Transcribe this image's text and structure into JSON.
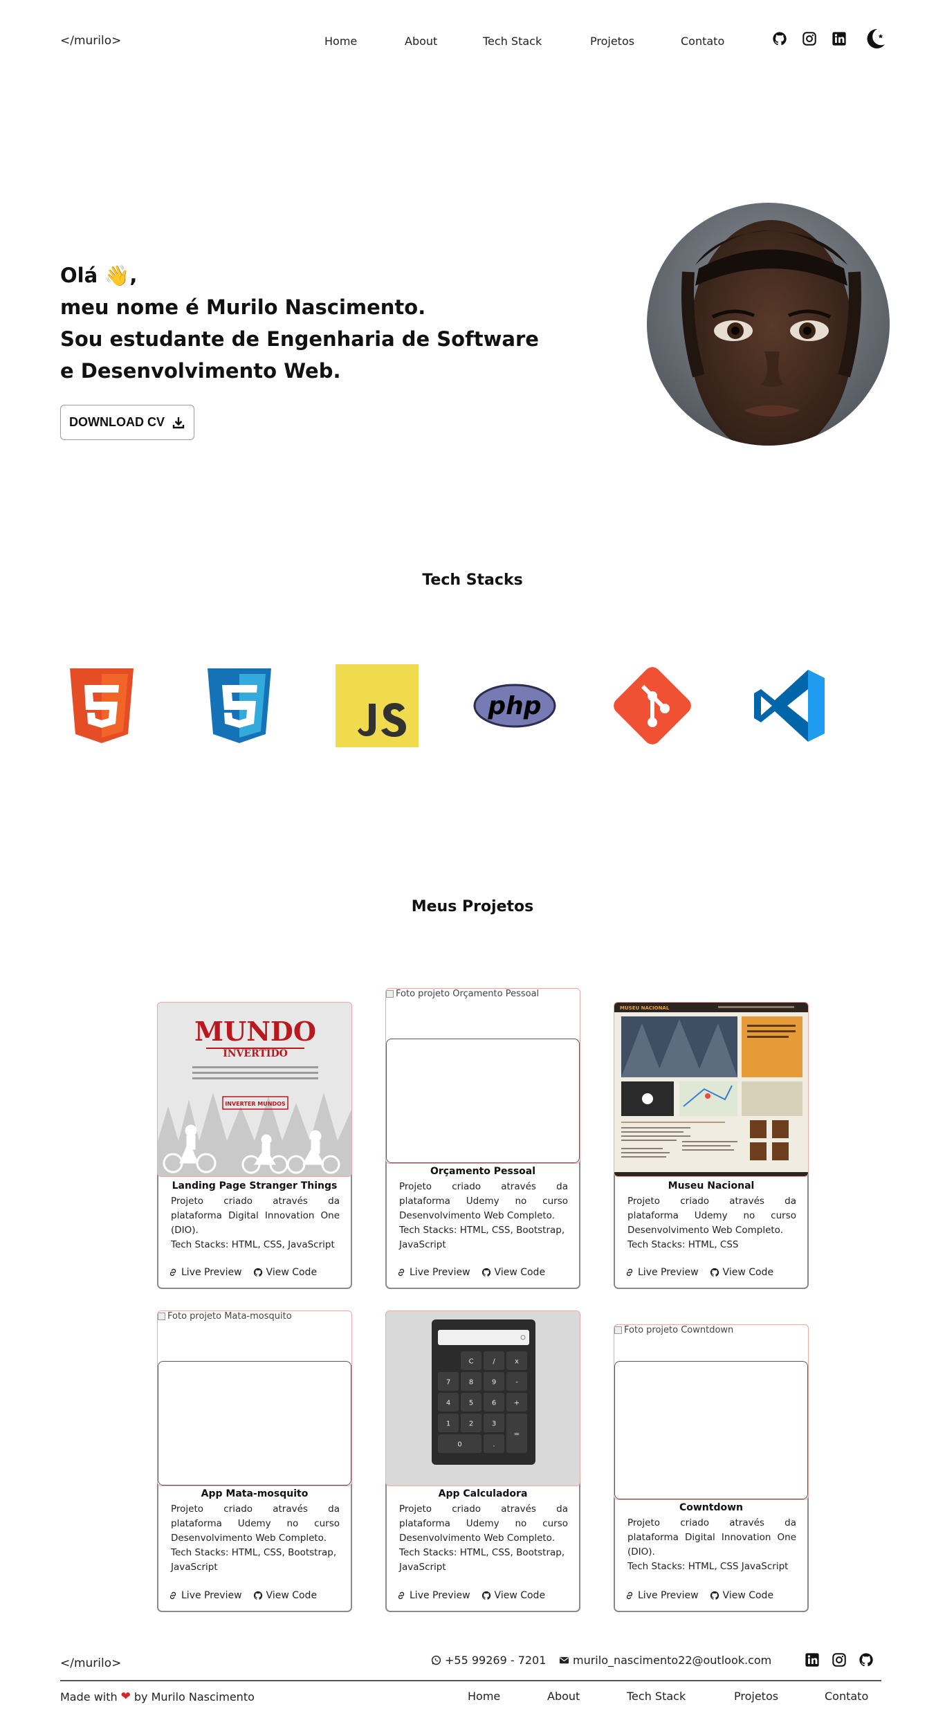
{
  "header": {
    "logo": "</murilo>",
    "nav": [
      "Home",
      "About",
      "Tech Stack",
      "Projetos",
      "Contato"
    ],
    "icons": [
      "github-icon",
      "instagram-icon",
      "linkedin-icon",
      "theme-toggle-icon"
    ]
  },
  "hero": {
    "line1": "Olá 👋,",
    "line2": "meu nome é Murilo Nascimento.",
    "line3": "Sou estudante de Engenharia de Software",
    "line4": "e Desenvolvimento Web.",
    "cv_label": "DOWNLOAD CV"
  },
  "tech": {
    "title": "Tech Stacks",
    "items": [
      "html5-logo",
      "css3-logo",
      "javascript-logo",
      "php-logo",
      "git-logo",
      "vscode-logo"
    ]
  },
  "projects": {
    "title": "Meus Projetos",
    "live_label": "Live Preview",
    "code_label": "View Code",
    "items": [
      {
        "title": "Landing Page Stranger Things",
        "desc": "Projeto criado através da plataforma Digital Innovation One (DIO).",
        "stack": "Tech Stacks: HTML, CSS, JavaScript",
        "thumb_heading": "MUNDO",
        "thumb_sub": "INVERTIDO",
        "thumb_button": "INVERTER MUNDOS"
      },
      {
        "title": "Orçamento Pessoal",
        "desc": "Projeto criado através da plataforma Udemy no curso Desenvolvimento Web Completo.",
        "stack": "Tech Stacks: HTML, CSS, Bootstrap, JavaScript",
        "alt": "Foto projeto Orçamento Pessoal"
      },
      {
        "title": "Museu Nacional",
        "desc": "Projeto criado através da plataforma Udemy no curso Desenvolvimento Web Completo.",
        "stack": "Tech Stacks: HTML, CSS",
        "thumb_brand": "MUSEU NACIONAL"
      },
      {
        "title": "App Mata-mosquito",
        "desc": "Projeto criado através da plataforma Udemy no curso Desenvolvimento Web Completo.",
        "stack": "Tech Stacks: HTML, CSS, Bootstrap, JavaScript",
        "alt": "Foto projeto Mata-mosquito"
      },
      {
        "title": "App Calculadora",
        "desc": "Projeto criado através da plataforma Udemy no curso Desenvolvimento Web Completo.",
        "stack": "Tech Stacks: HTML, CSS, Bootstrap, JavaScript",
        "calc_keys": [
          "C",
          "/",
          "x",
          "7",
          "8",
          "9",
          "-",
          "4",
          "5",
          "6",
          "+",
          "1",
          "2",
          "3",
          "=",
          "0",
          "."
        ]
      },
      {
        "title": "Cowntdown",
        "desc": "Projeto criado através da plataforma Digital Innovation One (DIO).",
        "stack": "Tech Stacks: HTML, CSS JavaScript",
        "alt": "Foto projeto Cowntdown"
      }
    ]
  },
  "footer": {
    "logo": "</murilo>",
    "phone": "+55 99269 - 7201",
    "email": "murilo_nascimento22@outlook.com",
    "made_prefix": "Made with",
    "made_suffix": "by Murilo Nascimento",
    "nav": [
      "Home",
      "About",
      "Tech Stack",
      "Projetos",
      "Contato"
    ]
  },
  "colors": {
    "accent_border": "#f2a7a4",
    "heart": "#d62727"
  }
}
